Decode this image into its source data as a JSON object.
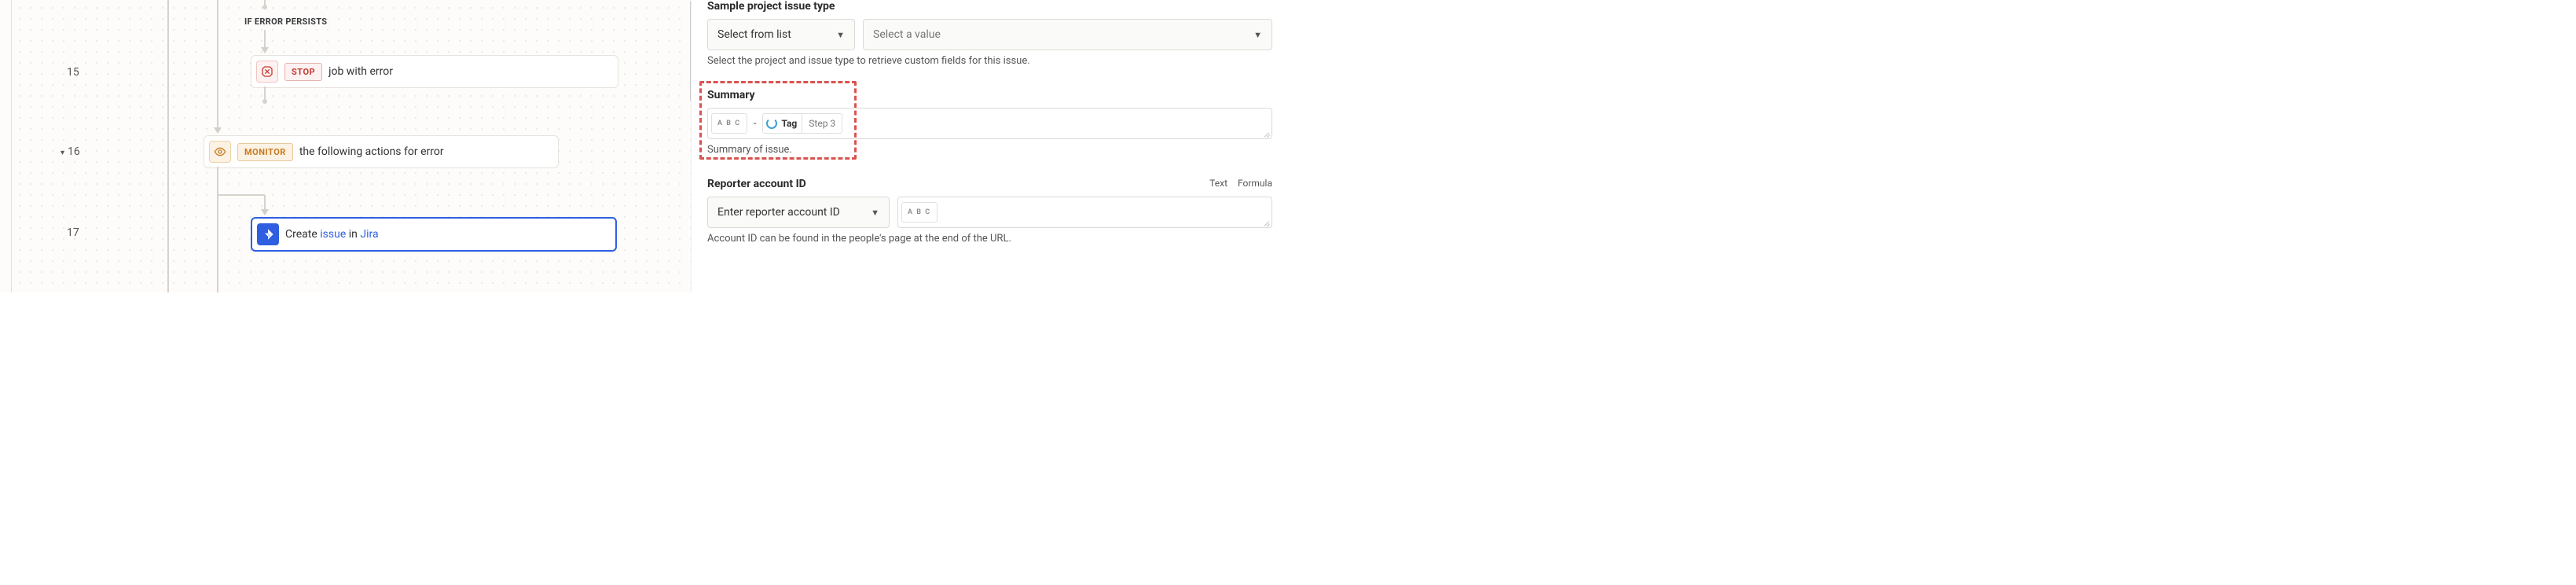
{
  "canvas": {
    "steps": [
      {
        "num": "15",
        "hasCaret": false
      },
      {
        "num": "16",
        "hasCaret": true
      },
      {
        "num": "17",
        "hasCaret": false
      }
    ],
    "section_label": "IF ERROR PERSISTS",
    "stop": {
      "badge": "STOP",
      "text": "job with error"
    },
    "monitor": {
      "badge": "MONITOR",
      "text": "the following actions for error"
    },
    "jira": {
      "prefix": "Create ",
      "link1": "issue",
      "mid": " in ",
      "link2": "Jira"
    }
  },
  "panel": {
    "issue_type": {
      "label": "Sample project issue type",
      "select_text": "Select from list",
      "value_placeholder": "Select a value",
      "help": "Select the project and issue type to retrieve custom fields for this issue."
    },
    "summary": {
      "label": "Summary",
      "abc": "A B C",
      "minus": "-",
      "tag_label": "Tag",
      "tag_step": "Step 3",
      "help": "Summary of issue."
    },
    "reporter": {
      "label": "Reporter account ID",
      "tab_text": "Text",
      "tab_formula": "Formula",
      "select_text": "Enter reporter account ID",
      "abc": "A B C",
      "help": "Account ID can be found in the people's page at the end of the URL."
    }
  }
}
